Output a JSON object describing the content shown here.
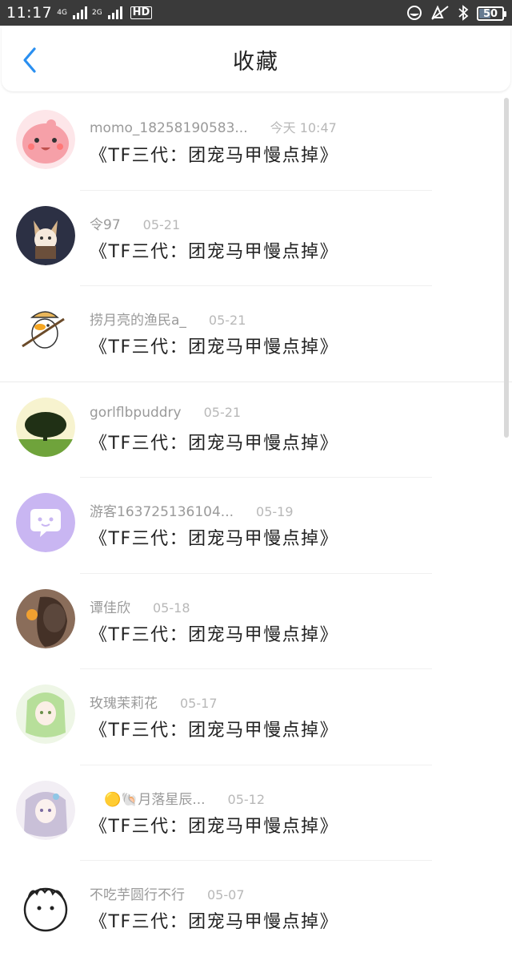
{
  "status_bar": {
    "time": "11:17",
    "net1": "4G",
    "net2": "2G",
    "hd": "HD",
    "battery": "50",
    "battery_level_percent": 50
  },
  "header": {
    "title": "收藏",
    "back_icon": "chevron-left-icon",
    "accent": "#2a8ff0"
  },
  "items": [
    {
      "user": "momo_18258190583...",
      "date": "今天 10:47",
      "book": "《TF三代：团宠马甲慢点掉》"
    },
    {
      "user": "令97",
      "date": "05-21",
      "book": "《TF三代：团宠马甲慢点掉》"
    },
    {
      "user": "捞月亮的渔民a_",
      "date": "05-21",
      "book": "《TF三代：团宠马甲慢点掉》"
    },
    {
      "user": "gorlflbpuddry",
      "date": "05-21",
      "book": "《TF三代：团宠马甲慢点掉》"
    },
    {
      "user": "游客163725136104...",
      "date": "05-19",
      "book": "《TF三代：团宠马甲慢点掉》"
    },
    {
      "user": "谭佳欣",
      "date": "05-18",
      "book": "《TF三代：团宠马甲慢点掉》"
    },
    {
      "user": "玫瑰茉莉花",
      "date": "05-17",
      "book": "《TF三代：团宠马甲慢点掉》"
    },
    {
      "user": "🟡🐚月落星辰...",
      "date": "05-12",
      "book": "《TF三代：团宠马甲慢点掉》"
    },
    {
      "user": "不吃芋圆行不行",
      "date": "05-07",
      "book": "《TF三代：团宠马甲慢点掉》"
    }
  ]
}
